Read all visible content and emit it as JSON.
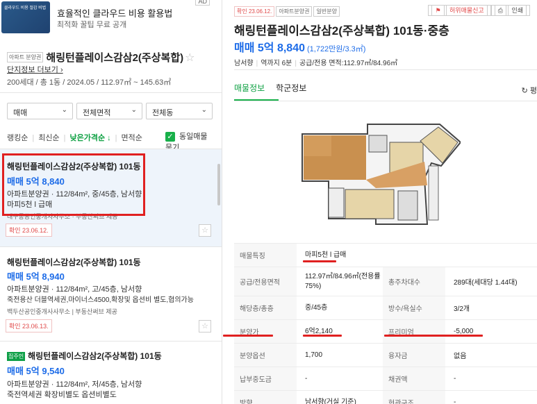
{
  "ad": {
    "thumb_text": "클라우드 비용 절감 비법",
    "title": "효율적인 클라우드 비용 활용법",
    "subtitle": "최적화 꿀팁 무료 공개",
    "badge": "AD"
  },
  "complex": {
    "tag": "아파트 분양권",
    "name": "해링턴플레이스감삼2(주상복합)",
    "star": "☆",
    "link": "단지정보 더보기 ›",
    "info": "200세대 / 총 1동 / 2024.05 / 112.97㎡ ~ 145.63㎡"
  },
  "filters": [
    {
      "label": "매매"
    },
    {
      "label": "전체면적"
    },
    {
      "label": "전체동"
    }
  ],
  "sorts": {
    "rank": "랭킹순",
    "latest": "최신순",
    "low_price": "낮은가격순 ↓",
    "area": "면적순",
    "same_listing": "동일매물 묶기"
  },
  "listings": [
    {
      "title": "해링턴플레이스감삼2(주상복합) 101동",
      "price": "매매 5억 8,840",
      "desc": "아파트분양권 · 112/84m², 중/45층, 남서향",
      "desc2": "마피5천 l 급매",
      "agent": "대구동공인중개사사무소 · 부동산써브 제공",
      "confirm": "확인 23.06.12."
    },
    {
      "title": "해링턴플레이스감삼2(주상복합) 101동",
      "price": "매매 5억 8,940",
      "desc": "아파트분양권 · 112/84m², 고/45층, 남서향",
      "desc2": "죽전용산 더블역세권,마이너스4500,확장및 옵션비 별도,협의가능",
      "agent": "백두산공인중개사사무소 | 부동산써브 제공",
      "confirm": "확인 23.06.13."
    },
    {
      "tag": "집주인",
      "title": "해링턴플레이스감삼2(주상복합) 101동",
      "price": "매매 5억 9,540",
      "desc": "아파트분양권 · 112/84m², 저/45층, 남서향",
      "desc2": "죽전역세권 확장비별도 옵션비별도"
    }
  ],
  "detail": {
    "tags": [
      "확인 23.06.12.",
      "아파트분양권",
      "일반분양"
    ],
    "report": "허위매물신고",
    "print": "인쇄",
    "title": "해링턴플레이스감삼2(주상복합) 101동·중층",
    "price": "매매 5억 8,840",
    "price_per": "(1,722만원/3.3㎡)",
    "summary": [
      "남서향",
      "역까지 6분",
      "공급/전용 면적:112.97㎡/84.96㎡"
    ],
    "tabs": [
      "매물정보",
      "학군정보"
    ],
    "tab_right": "↻ 평"
  },
  "table": [
    {
      "h": "매물특징",
      "v": "마피5천 l 급매"
    },
    {
      "h": "공급/전용면적",
      "v": "112.97㎡/84.96㎡(전용률75%)",
      "h2": "총주차대수",
      "v2": "289대(세대당 1.44대)"
    },
    {
      "h": "해당층/총층",
      "v": "중/45층",
      "h2": "방수/욕실수",
      "v2": "3/2개"
    },
    {
      "h": "분양가",
      "v": "6억2,140",
      "h2": "프리미엄",
      "v2": "-5,000"
    },
    {
      "h": "분양옵션",
      "v": "1,700",
      "h2": "융자금",
      "v2": "없음"
    },
    {
      "h": "납부중도금",
      "v": "-",
      "h2": "채권액",
      "v2": "-"
    },
    {
      "h": "방향",
      "v": "남서향(거실 기준)",
      "h2": "현관구조",
      "v2": "-"
    }
  ],
  "colors": {
    "accent_green": "#0da042",
    "price_blue": "#1d6ce8",
    "highlight_red": "#e02020"
  }
}
